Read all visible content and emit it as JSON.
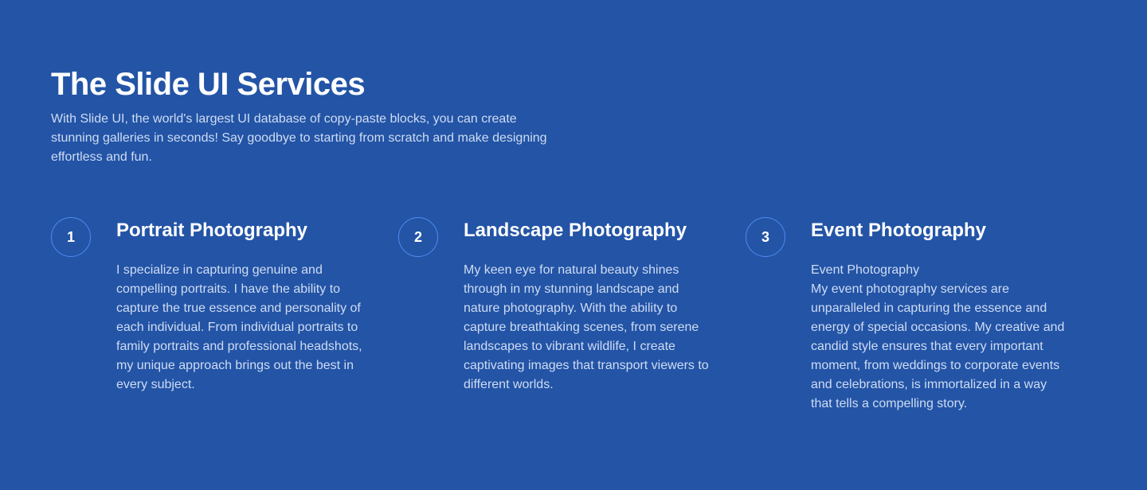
{
  "header": {
    "title": "The Slide UI Services",
    "intro": "With Slide UI, the world's largest UI database of copy-paste blocks, you can create stunning galleries in seconds! Say goodbye to starting from scratch and make designing effortless and fun."
  },
  "services": [
    {
      "number": "1",
      "title": "Portrait Photography",
      "text": "I specialize in capturing genuine and compelling portraits. I have the ability to capture the true essence and personality of each individual. From individual portraits to family portraits and professional headshots, my unique approach brings out the best in every subject."
    },
    {
      "number": "2",
      "title": "Landscape Photography",
      "text": "My keen eye for natural beauty shines through in my stunning landscape and nature photography. With the ability to capture breathtaking scenes, from serene landscapes to vibrant wildlife, I create captivating images that transport viewers to different worlds."
    },
    {
      "number": "3",
      "title": "Event Photography",
      "subtitle": "Event Photography",
      "text": "My event photography services are unparalleled in capturing the essence and energy of special occasions. My creative and candid style ensures that every important moment, from weddings to corporate events and celebrations, is immortalized in a way that tells a compelling story."
    }
  ],
  "colors": {
    "background": "#2354a6",
    "heading": "#ffffff",
    "body_text": "#cfdcf3",
    "circle_border": "#4d8bf0"
  }
}
